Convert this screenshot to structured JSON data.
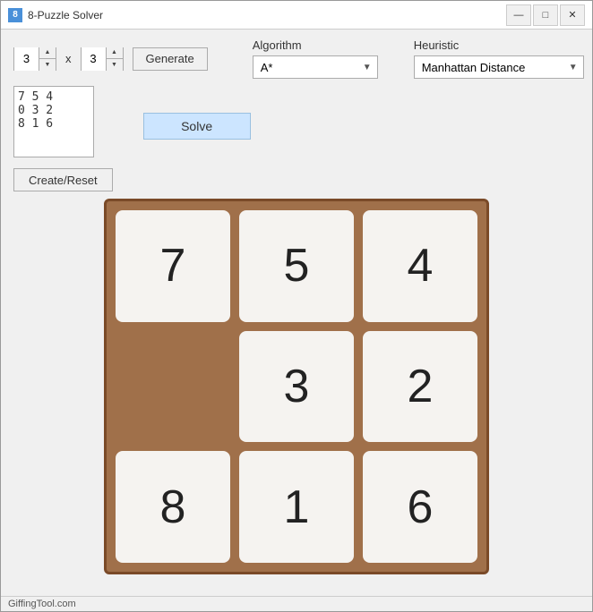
{
  "window": {
    "title": "8-Puzzle Solver",
    "title_icon": "8"
  },
  "title_controls": {
    "minimize": "—",
    "maximize": "□",
    "close": "✕"
  },
  "spinner1": {
    "value": "3"
  },
  "spinner2": {
    "value": "3"
  },
  "x_label": "x",
  "generate_btn": "Generate",
  "algorithm": {
    "label": "Algorithm",
    "value": "A*"
  },
  "heuristic": {
    "label": "Heuristic",
    "value": "Manhattan Distance"
  },
  "text_area": {
    "content": "7 5 4\n0 3 2\n8 1 6"
  },
  "solve_btn": "Solve",
  "create_reset_btn": "Create/Reset",
  "puzzle": {
    "tiles": [
      7,
      5,
      4,
      0,
      3,
      2,
      8,
      1,
      6
    ]
  },
  "footer": {
    "text": "GiffingTool.com"
  }
}
